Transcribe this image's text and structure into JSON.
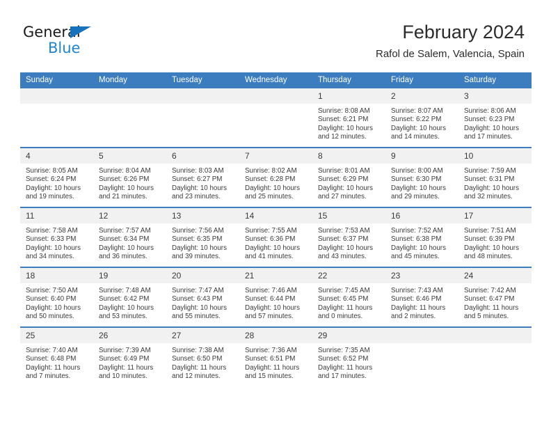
{
  "brand": {
    "name_line1": "General",
    "name_line2": "Blue",
    "triangle_color": "#1573bd",
    "text_color": "#1f86d4"
  },
  "header": {
    "title": "February 2024",
    "subtitle": "Rafol de Salem, Valencia, Spain"
  },
  "theme": {
    "header_blue": "#3c7dc0",
    "daynum_band": "#f1f1f1",
    "text": "#3a3a3a"
  },
  "weekday_headers": [
    "Sunday",
    "Monday",
    "Tuesday",
    "Wednesday",
    "Thursday",
    "Friday",
    "Saturday"
  ],
  "labels": {
    "sunrise_prefix": "Sunrise:",
    "sunset_prefix": "Sunset:",
    "daylight_prefix": "Daylight:"
  },
  "weeks": [
    {
      "days": [
        {
          "num": "",
          "sunrise": "",
          "sunset": "",
          "daylight_line1": "",
          "daylight_line2": "",
          "blank": true
        },
        {
          "num": "",
          "sunrise": "",
          "sunset": "",
          "daylight_line1": "",
          "daylight_line2": "",
          "blank": true
        },
        {
          "num": "",
          "sunrise": "",
          "sunset": "",
          "daylight_line1": "",
          "daylight_line2": "",
          "blank": true
        },
        {
          "num": "",
          "sunrise": "",
          "sunset": "",
          "daylight_line1": "",
          "daylight_line2": "",
          "blank": true
        },
        {
          "num": "1",
          "sunrise": "Sunrise: 8:08 AM",
          "sunset": "Sunset: 6:21 PM",
          "daylight_line1": "Daylight: 10 hours",
          "daylight_line2": "and 12 minutes."
        },
        {
          "num": "2",
          "sunrise": "Sunrise: 8:07 AM",
          "sunset": "Sunset: 6:22 PM",
          "daylight_line1": "Daylight: 10 hours",
          "daylight_line2": "and 14 minutes."
        },
        {
          "num": "3",
          "sunrise": "Sunrise: 8:06 AM",
          "sunset": "Sunset: 6:23 PM",
          "daylight_line1": "Daylight: 10 hours",
          "daylight_line2": "and 17 minutes."
        }
      ]
    },
    {
      "days": [
        {
          "num": "4",
          "sunrise": "Sunrise: 8:05 AM",
          "sunset": "Sunset: 6:24 PM",
          "daylight_line1": "Daylight: 10 hours",
          "daylight_line2": "and 19 minutes."
        },
        {
          "num": "5",
          "sunrise": "Sunrise: 8:04 AM",
          "sunset": "Sunset: 6:26 PM",
          "daylight_line1": "Daylight: 10 hours",
          "daylight_line2": "and 21 minutes."
        },
        {
          "num": "6",
          "sunrise": "Sunrise: 8:03 AM",
          "sunset": "Sunset: 6:27 PM",
          "daylight_line1": "Daylight: 10 hours",
          "daylight_line2": "and 23 minutes."
        },
        {
          "num": "7",
          "sunrise": "Sunrise: 8:02 AM",
          "sunset": "Sunset: 6:28 PM",
          "daylight_line1": "Daylight: 10 hours",
          "daylight_line2": "and 25 minutes."
        },
        {
          "num": "8",
          "sunrise": "Sunrise: 8:01 AM",
          "sunset": "Sunset: 6:29 PM",
          "daylight_line1": "Daylight: 10 hours",
          "daylight_line2": "and 27 minutes."
        },
        {
          "num": "9",
          "sunrise": "Sunrise: 8:00 AM",
          "sunset": "Sunset: 6:30 PM",
          "daylight_line1": "Daylight: 10 hours",
          "daylight_line2": "and 29 minutes."
        },
        {
          "num": "10",
          "sunrise": "Sunrise: 7:59 AM",
          "sunset": "Sunset: 6:31 PM",
          "daylight_line1": "Daylight: 10 hours",
          "daylight_line2": "and 32 minutes."
        }
      ]
    },
    {
      "days": [
        {
          "num": "11",
          "sunrise": "Sunrise: 7:58 AM",
          "sunset": "Sunset: 6:33 PM",
          "daylight_line1": "Daylight: 10 hours",
          "daylight_line2": "and 34 minutes."
        },
        {
          "num": "12",
          "sunrise": "Sunrise: 7:57 AM",
          "sunset": "Sunset: 6:34 PM",
          "daylight_line1": "Daylight: 10 hours",
          "daylight_line2": "and 36 minutes."
        },
        {
          "num": "13",
          "sunrise": "Sunrise: 7:56 AM",
          "sunset": "Sunset: 6:35 PM",
          "daylight_line1": "Daylight: 10 hours",
          "daylight_line2": "and 39 minutes."
        },
        {
          "num": "14",
          "sunrise": "Sunrise: 7:55 AM",
          "sunset": "Sunset: 6:36 PM",
          "daylight_line1": "Daylight: 10 hours",
          "daylight_line2": "and 41 minutes."
        },
        {
          "num": "15",
          "sunrise": "Sunrise: 7:53 AM",
          "sunset": "Sunset: 6:37 PM",
          "daylight_line1": "Daylight: 10 hours",
          "daylight_line2": "and 43 minutes."
        },
        {
          "num": "16",
          "sunrise": "Sunrise: 7:52 AM",
          "sunset": "Sunset: 6:38 PM",
          "daylight_line1": "Daylight: 10 hours",
          "daylight_line2": "and 45 minutes."
        },
        {
          "num": "17",
          "sunrise": "Sunrise: 7:51 AM",
          "sunset": "Sunset: 6:39 PM",
          "daylight_line1": "Daylight: 10 hours",
          "daylight_line2": "and 48 minutes."
        }
      ]
    },
    {
      "days": [
        {
          "num": "18",
          "sunrise": "Sunrise: 7:50 AM",
          "sunset": "Sunset: 6:40 PM",
          "daylight_line1": "Daylight: 10 hours",
          "daylight_line2": "and 50 minutes."
        },
        {
          "num": "19",
          "sunrise": "Sunrise: 7:48 AM",
          "sunset": "Sunset: 6:42 PM",
          "daylight_line1": "Daylight: 10 hours",
          "daylight_line2": "and 53 minutes."
        },
        {
          "num": "20",
          "sunrise": "Sunrise: 7:47 AM",
          "sunset": "Sunset: 6:43 PM",
          "daylight_line1": "Daylight: 10 hours",
          "daylight_line2": "and 55 minutes."
        },
        {
          "num": "21",
          "sunrise": "Sunrise: 7:46 AM",
          "sunset": "Sunset: 6:44 PM",
          "daylight_line1": "Daylight: 10 hours",
          "daylight_line2": "and 57 minutes."
        },
        {
          "num": "22",
          "sunrise": "Sunrise: 7:45 AM",
          "sunset": "Sunset: 6:45 PM",
          "daylight_line1": "Daylight: 11 hours",
          "daylight_line2": "and 0 minutes."
        },
        {
          "num": "23",
          "sunrise": "Sunrise: 7:43 AM",
          "sunset": "Sunset: 6:46 PM",
          "daylight_line1": "Daylight: 11 hours",
          "daylight_line2": "and 2 minutes."
        },
        {
          "num": "24",
          "sunrise": "Sunrise: 7:42 AM",
          "sunset": "Sunset: 6:47 PM",
          "daylight_line1": "Daylight: 11 hours",
          "daylight_line2": "and 5 minutes."
        }
      ]
    },
    {
      "days": [
        {
          "num": "25",
          "sunrise": "Sunrise: 7:40 AM",
          "sunset": "Sunset: 6:48 PM",
          "daylight_line1": "Daylight: 11 hours",
          "daylight_line2": "and 7 minutes."
        },
        {
          "num": "26",
          "sunrise": "Sunrise: 7:39 AM",
          "sunset": "Sunset: 6:49 PM",
          "daylight_line1": "Daylight: 11 hours",
          "daylight_line2": "and 10 minutes."
        },
        {
          "num": "27",
          "sunrise": "Sunrise: 7:38 AM",
          "sunset": "Sunset: 6:50 PM",
          "daylight_line1": "Daylight: 11 hours",
          "daylight_line2": "and 12 minutes."
        },
        {
          "num": "28",
          "sunrise": "Sunrise: 7:36 AM",
          "sunset": "Sunset: 6:51 PM",
          "daylight_line1": "Daylight: 11 hours",
          "daylight_line2": "and 15 minutes."
        },
        {
          "num": "29",
          "sunrise": "Sunrise: 7:35 AM",
          "sunset": "Sunset: 6:52 PM",
          "daylight_line1": "Daylight: 11 hours",
          "daylight_line2": "and 17 minutes."
        },
        {
          "num": "",
          "sunrise": "",
          "sunset": "",
          "daylight_line1": "",
          "daylight_line2": "",
          "blank": true
        },
        {
          "num": "",
          "sunrise": "",
          "sunset": "",
          "daylight_line1": "",
          "daylight_line2": "",
          "blank": true
        }
      ]
    }
  ]
}
